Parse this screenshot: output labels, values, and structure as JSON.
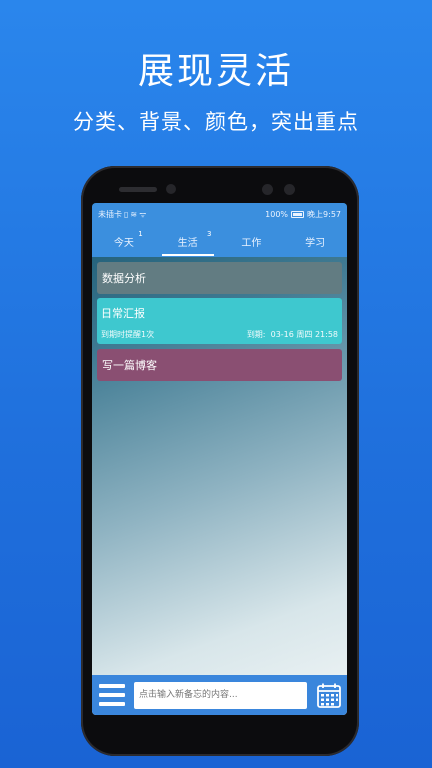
{
  "promo": {
    "headline": "展现灵活",
    "subline": "分类、背景、颜色，突出重点"
  },
  "statusbar": {
    "carrier": "未插卡",
    "battery": "100%",
    "time": "晚上9:57"
  },
  "tabs": [
    {
      "label": "今天",
      "badge": "1",
      "active": false
    },
    {
      "label": "生活",
      "badge": "3",
      "active": true
    },
    {
      "label": "工作",
      "badge": "",
      "active": false
    },
    {
      "label": "学习",
      "badge": "",
      "active": false
    }
  ],
  "notes": [
    {
      "title": "数据分析",
      "color": "#627c82"
    },
    {
      "title": "日常汇报",
      "reminder": "到期时提醒1次",
      "due_label": "到期:",
      "due": "03-16 周四 21:58",
      "color": "#3ec8cf"
    },
    {
      "title": "写一篇博客",
      "color": "#8a4f72"
    }
  ],
  "bottombar": {
    "input_placeholder": "点击输入新备忘的内容...",
    "menu_icon": "menu-icon",
    "calendar_icon": "calendar-icon"
  },
  "colors": {
    "background": "#2a86ec",
    "accent": "#3b8fde"
  }
}
